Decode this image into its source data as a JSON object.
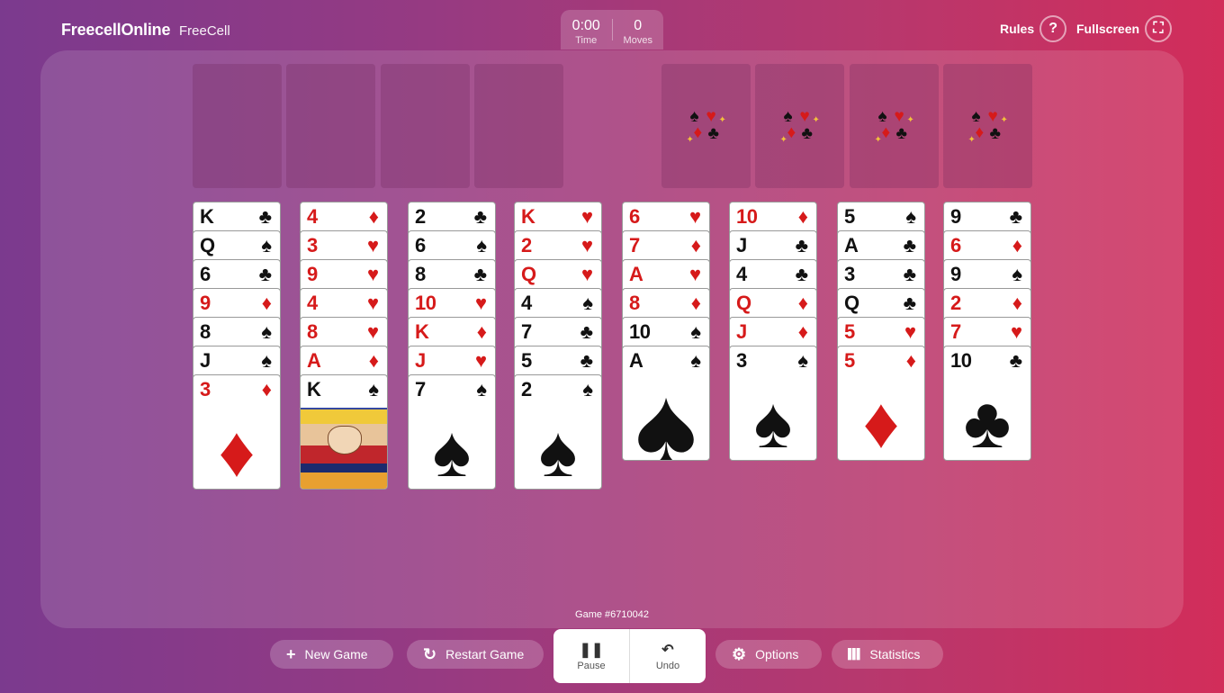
{
  "header": {
    "logo": "FreecellOnline",
    "game_name": "FreeCell",
    "time_value": "0:00",
    "time_label": "Time",
    "moves_value": "0",
    "moves_label": "Moves",
    "rules_label": "Rules",
    "rules_icon": "?",
    "fullscreen_label": "Fullscreen",
    "fullscreen_icon": "⛶"
  },
  "foundation_symbols": {
    "spade": "♠",
    "heart": "♥",
    "diamond": "♦",
    "club": "♣",
    "sparkle": "✦"
  },
  "tableau": [
    [
      [
        "K",
        "♣",
        "black"
      ],
      [
        "Q",
        "♠",
        "black"
      ],
      [
        "6",
        "♣",
        "black"
      ],
      [
        "9",
        "♦",
        "red"
      ],
      [
        "8",
        "♠",
        "black"
      ],
      [
        "J",
        "♠",
        "black"
      ],
      [
        "3",
        "♦",
        "red"
      ]
    ],
    [
      [
        "4",
        "♦",
        "red"
      ],
      [
        "3",
        "♥",
        "red"
      ],
      [
        "9",
        "♥",
        "red"
      ],
      [
        "4",
        "♥",
        "red"
      ],
      [
        "8",
        "♥",
        "red"
      ],
      [
        "A",
        "♦",
        "red"
      ],
      [
        "K",
        "♠",
        "black"
      ]
    ],
    [
      [
        "2",
        "♣",
        "black"
      ],
      [
        "6",
        "♠",
        "black"
      ],
      [
        "8",
        "♣",
        "black"
      ],
      [
        "10",
        "♥",
        "red"
      ],
      [
        "K",
        "♦",
        "red"
      ],
      [
        "J",
        "♥",
        "red"
      ],
      [
        "7",
        "♠",
        "black"
      ]
    ],
    [
      [
        "K",
        "♥",
        "red"
      ],
      [
        "2",
        "♥",
        "red"
      ],
      [
        "Q",
        "♥",
        "red"
      ],
      [
        "4",
        "♠",
        "black"
      ],
      [
        "7",
        "♣",
        "black"
      ],
      [
        "5",
        "♣",
        "black"
      ],
      [
        "2",
        "♠",
        "black"
      ]
    ],
    [
      [
        "6",
        "♥",
        "red"
      ],
      [
        "7",
        "♦",
        "red"
      ],
      [
        "A",
        "♥",
        "red"
      ],
      [
        "8",
        "♦",
        "red"
      ],
      [
        "10",
        "♠",
        "black"
      ],
      [
        "A",
        "♠",
        "black"
      ]
    ],
    [
      [
        "10",
        "♦",
        "red"
      ],
      [
        "J",
        "♣",
        "black"
      ],
      [
        "4",
        "♣",
        "black"
      ],
      [
        "Q",
        "♦",
        "red"
      ],
      [
        "J",
        "♦",
        "red"
      ],
      [
        "3",
        "♠",
        "black"
      ]
    ],
    [
      [
        "5",
        "♠",
        "black"
      ],
      [
        "A",
        "♣",
        "black"
      ],
      [
        "3",
        "♣",
        "black"
      ],
      [
        "Q",
        "♣",
        "black"
      ],
      [
        "5",
        "♥",
        "red"
      ],
      [
        "5",
        "♦",
        "red"
      ]
    ],
    [
      [
        "9",
        "♣",
        "black"
      ],
      [
        "6",
        "♦",
        "red"
      ],
      [
        "9",
        "♠",
        "black"
      ],
      [
        "2",
        "♦",
        "red"
      ],
      [
        "7",
        "♥",
        "red"
      ],
      [
        "10",
        "♣",
        "black"
      ]
    ]
  ],
  "game_number": "Game #6710042",
  "bottom": {
    "new_game": "New Game",
    "new_game_icon": "+",
    "restart": "Restart Game",
    "restart_icon": "↻",
    "pause": "Pause",
    "pause_icon": "❚❚",
    "undo": "Undo",
    "undo_icon": "↶",
    "options": "Options",
    "options_icon": "⚙",
    "statistics": "Statistics",
    "statistics_icon": "▌▌▌"
  }
}
